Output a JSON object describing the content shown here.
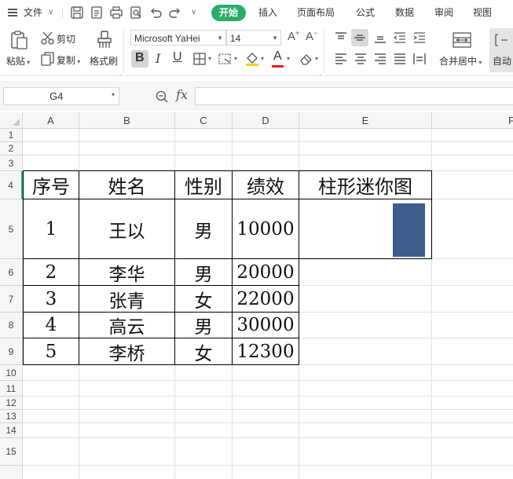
{
  "menubar": {
    "file_label": "文件",
    "tabs": [
      "开始",
      "插入",
      "页面布局",
      "公式",
      "数据",
      "审阅",
      "视图"
    ]
  },
  "ribbon": {
    "paste_label": "粘贴",
    "cut_label": "剪切",
    "copy_label": "复制",
    "format_painter_label": "格式刷",
    "font_name": "Microsoft YaHei",
    "font_size": "14",
    "merge_label": "合并居中",
    "auto_label": "自动",
    "font_color": "#e02020",
    "fill_color": "#f2d200"
  },
  "formula_bar": {
    "name_box": "G4",
    "fx_label": "fx",
    "formula": ""
  },
  "sheet": {
    "columns": [
      "A",
      "B",
      "C",
      "D",
      "E",
      "F"
    ],
    "rows": [
      "1",
      "2",
      "3",
      "4",
      "5",
      "6",
      "7",
      "8",
      "9",
      "10",
      "11",
      "12",
      "13",
      "14",
      "15"
    ],
    "headers": [
      "序号",
      "姓名",
      "性别",
      "绩效",
      "柱形迷你图"
    ],
    "data": [
      [
        "1",
        "王以",
        "男",
        "10000"
      ],
      [
        "2",
        "李华",
        "男",
        "20000"
      ],
      [
        "3",
        "张青",
        "女",
        "22000"
      ],
      [
        "4",
        "高云",
        "男",
        "30000"
      ],
      [
        "5",
        "李桥",
        "女",
        "12300"
      ]
    ],
    "sparkline_color": "#3b5e8c"
  }
}
